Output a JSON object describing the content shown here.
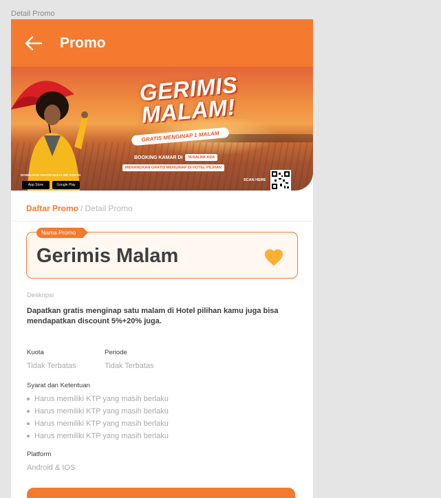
{
  "frame": {
    "label": "Detail Promo"
  },
  "header": {
    "title": "Promo"
  },
  "banner": {
    "title_line1": "GERIMIS",
    "title_line2": "MALAM!",
    "subtitle": "GRATIS MENGINAP 1 MALAM",
    "booking_text": "BOOKING KAMAR DI",
    "booking_pill": "NUSALINK ASIA",
    "win_text": "MENANGKAN GRATIS MENGINAP DI HOTEL PILIHAN",
    "scan_text": "SCAN HERE",
    "download_text": "DOWNLOAD GRATIS NUSALINK ASIA DI",
    "app_store": "App Store",
    "google_play": "Google Play"
  },
  "breadcrumb": {
    "parent": "Daftar Promo",
    "separator": "/",
    "current": "Detail Promo"
  },
  "promo": {
    "name_tag": "Nama Promo",
    "name": "Gerimis Malam",
    "description_label": "Deskripsi",
    "description": "Dapatkan gratis menginap satu malam di Hotel pilihan  kamu juga bisa mendapatkan discount 5%+20% juga.",
    "quota_label": "Kuota",
    "quota_value": "Tidak Terbatas",
    "period_label": "Periode",
    "period_value": "Tidak Terbatas",
    "terms_label": "Syarat dan Ketentuan",
    "terms": [
      "Harus memiliki KTP yang masih berlaku",
      "Harus memiliki KTP yang masih berlaku",
      "Harus memiliki KTP yang masih berlaku",
      "Harus memiliki KTP yang masih berlaku"
    ],
    "platform_label": "Platform",
    "platform_value": "Android & IOS"
  },
  "colors": {
    "brand": "#f47a2f",
    "heart": "#fbb034",
    "card_bg": "#fff7f0"
  },
  "icons": {
    "back": "arrow-left-icon",
    "favorite": "heart-icon"
  }
}
